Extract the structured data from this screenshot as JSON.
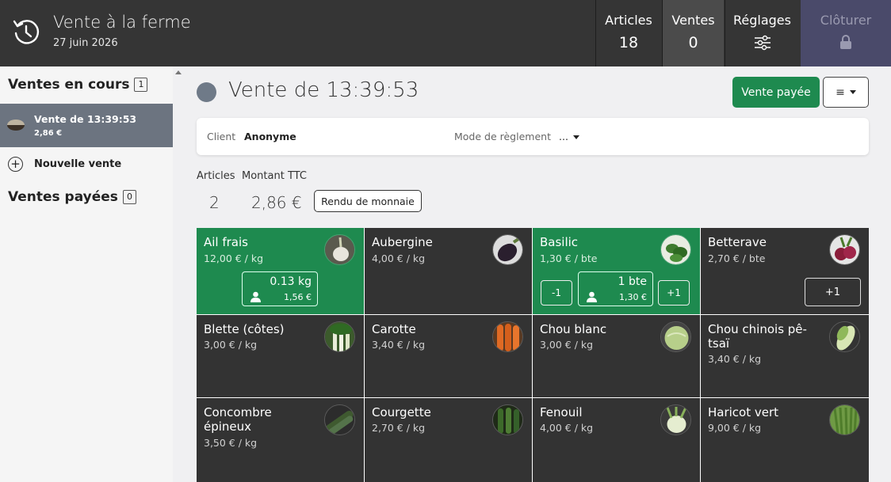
{
  "header": {
    "title": "Vente à la ferme",
    "date": "27 juin 2026",
    "nav": [
      {
        "label": "Articles",
        "value": "18"
      },
      {
        "label": "Ventes",
        "value": "0"
      },
      {
        "label": "Réglages"
      },
      {
        "label": "Clôturer"
      }
    ]
  },
  "sidebar": {
    "current_heading": "Ventes en cours",
    "current_count": "1",
    "current_sale": {
      "name": "Vente de 13:39:53",
      "amount": "2,86 €"
    },
    "new_sale_label": "Nouvelle vente",
    "paid_heading": "Ventes payées",
    "paid_count": "0"
  },
  "sale": {
    "title": "Vente de 13:39:53",
    "paid_button": "Vente payée",
    "menu_icon": "≡",
    "client_label": "Client",
    "client_value": "Anonyme",
    "mode_label": "Mode de règlement",
    "mode_value": "...",
    "articles_label": "Articles",
    "articles_value": "2",
    "amount_label": "Montant TTC",
    "amount_value": "2,86 €",
    "change_button": "Rendu de monnaie"
  },
  "products": [
    {
      "name": "Ail frais",
      "price": "12,00 € / kg",
      "icon": "garlic-icon",
      "active": true,
      "qty": "0.13 kg",
      "subtotal": "1,56 €"
    },
    {
      "name": "Aubergine",
      "price": "4,00 € / kg",
      "icon": "eggplant-icon"
    },
    {
      "name": "Basilic",
      "price": "1,30 € / bte",
      "icon": "basil-icon",
      "active": true,
      "qty": "1 bte",
      "subtotal": "1,30 €",
      "minus": "-1",
      "plus": "+1"
    },
    {
      "name": "Betterave",
      "price": "2,70 € / bte",
      "icon": "beet-icon",
      "plus": "+1"
    },
    {
      "name": "Blette (côtes)",
      "price": "3,00 € / kg",
      "icon": "chard-icon"
    },
    {
      "name": "Carotte",
      "price": "3,40 € / kg",
      "icon": "carrot-icon"
    },
    {
      "name": "Chou blanc",
      "price": "3,00 € / kg",
      "icon": "cabbage-icon"
    },
    {
      "name": "Chou chinois pê-tsaï",
      "price": "3,40 € / kg",
      "icon": "chinese-cabbage-icon"
    },
    {
      "name": "Concombre épineux",
      "price": "3,50 € / kg",
      "icon": "cucumber-icon"
    },
    {
      "name": "Courgette",
      "price": "2,70 € / kg",
      "icon": "zucchini-icon"
    },
    {
      "name": "Fenouil",
      "price": "4,00 € / kg",
      "icon": "fennel-icon"
    },
    {
      "name": "Haricot vert",
      "price": "9,00 € / kg",
      "icon": "green-bean-icon"
    }
  ],
  "colors": {
    "topbar": "#353535",
    "active_green": "#1e8a4f",
    "close_button": "#4a4a6a",
    "selected_sale": "#6c7480",
    "tile_dark": "#333333"
  }
}
